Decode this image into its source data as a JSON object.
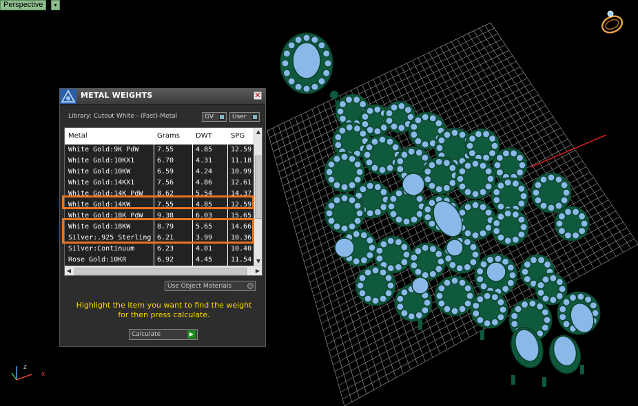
{
  "viewport": {
    "view_label": "Perspective",
    "view_menu_glyph": "▾",
    "background_color": "#000000",
    "grid_color": "#8a8a8a",
    "model_metal_color": "#0f5a3c",
    "stone_color": "#8ab8e8"
  },
  "panel": {
    "title": "METAL WEIGHTS",
    "close_glyph": "✕",
    "library_text": "Library: Cutout White - (Fast)-Metal",
    "gv_label": "GV",
    "user_label": "User",
    "columns": [
      "Metal",
      "Grams",
      "DWT",
      "SPG"
    ],
    "rows": [
      {
        "metal": "White Gold:9K PdW",
        "grams": "7.55",
        "dwt": "4.85",
        "spg": "12.59"
      },
      {
        "metal": "White Gold:10KX1",
        "grams": "6.70",
        "dwt": "4.31",
        "spg": "11.18"
      },
      {
        "metal": "White Gold:10KW",
        "grams": "6.59",
        "dwt": "4.24",
        "spg": "10.99"
      },
      {
        "metal": "White Gold:14KX1",
        "grams": "7.56",
        "dwt": "4.86",
        "spg": "12.61"
      },
      {
        "metal": "White Gold:14K PdW",
        "grams": "8.62",
        "dwt": "5.54",
        "spg": "14.37"
      },
      {
        "metal": "White Gold:14KW",
        "grams": "7.55",
        "dwt": "4.85",
        "spg": "12.59"
      },
      {
        "metal": "White Gold:18K PdW",
        "grams": "9.38",
        "dwt": "6.03",
        "spg": "15.65"
      },
      {
        "metal": "White Gold:18KW",
        "grams": "8.79",
        "dwt": "5.65",
        "spg": "14.66"
      },
      {
        "metal": "Silver:.925 Sterling",
        "grams": "6.21",
        "dwt": "3.99",
        "spg": "10.36"
      },
      {
        "metal": "Silver:Continuum",
        "grams": "6.23",
        "dwt": "4.01",
        "spg": "10.40"
      },
      {
        "metal": "Rose Gold:10KR",
        "grams": "6.92",
        "dwt": "4.45",
        "spg": "11.54"
      }
    ],
    "use_object_materials_label": "Use Object Materials",
    "instruction_line1": "Highlight the item you want to find the weight",
    "instruction_line2": "for then press calculate.",
    "calculate_label": "Calculate",
    "highlight_color": "#e8741f",
    "instruction_color": "#ffd700"
  },
  "axes": {
    "x_label": "x",
    "z_label": "z"
  }
}
